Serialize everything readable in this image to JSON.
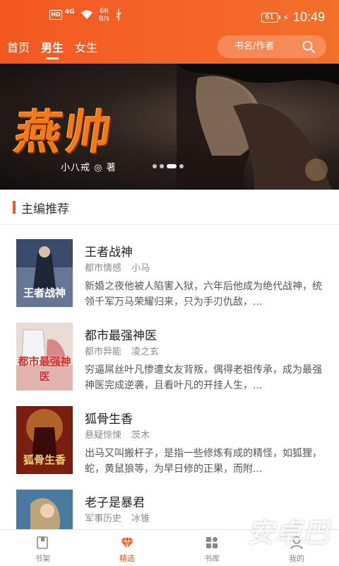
{
  "status_bar": {
    "hd": "HD",
    "network": "4G",
    "speed_value": "66",
    "speed_unit": "B/s",
    "battery": "61",
    "time": "10:49"
  },
  "nav": {
    "tabs": [
      {
        "label": "首页",
        "active": false
      },
      {
        "label": "男生",
        "active": true
      },
      {
        "label": "女生",
        "active": false
      }
    ],
    "search_placeholder": "书名/作者"
  },
  "banner": {
    "title": "燕帅",
    "author_line": "小八戒 ◎ 著",
    "slides": 4,
    "active_slide": 3
  },
  "section": {
    "title": "主编推荐"
  },
  "books": [
    {
      "title": "王者战神",
      "category": "都市情感",
      "author": "小马",
      "desc": "新婚之夜他被人陷害入狱，六年后他成为绝代战神，统领千军万马荣耀归来，只为手刃仇敌，...",
      "cover_text": "王者战神",
      "cover_colors": [
        "#3a4a6a",
        "#8a9ab8"
      ]
    },
    {
      "title": "都市最强神医",
      "category": "都市异能",
      "author": "凌之玄",
      "desc": "穷逼屌丝叶凡惨遭女友背叛，偶得老祖传承，成为最强神医完成逆袭，且看叶凡的开挂人生，...",
      "cover_text": "都市最强神医",
      "cover_colors": [
        "#e8dcd4",
        "#c83a3a"
      ]
    },
    {
      "title": "狐骨生香",
      "category": "悬疑惊悚",
      "author": "茨木",
      "desc": "出马又叫搬杆子，是指一些修炼有成的精怪，如狐狸，蛇，黄鼠狼等，为早日修的正果，而附...",
      "cover_text": "狐骨生香",
      "cover_colors": [
        "#7a1e12",
        "#e09a3a"
      ]
    },
    {
      "title": "老子是暴君",
      "category": "军事历史",
      "author": "冰锥",
      "desc": "",
      "cover_text": "",
      "cover_colors": [
        "#4a7aa0",
        "#d8b070"
      ]
    }
  ],
  "tabbar": [
    {
      "label": "书架",
      "icon": "bookshelf-icon",
      "active": false
    },
    {
      "label": "精选",
      "icon": "diamond-icon",
      "active": true
    },
    {
      "label": "书库",
      "icon": "grid-icon",
      "active": false
    },
    {
      "label": "我的",
      "icon": "user-icon",
      "active": false
    }
  ],
  "watermark": "安卓巴",
  "colors": {
    "accent": "#f2581f",
    "text_primary": "#222222",
    "text_secondary": "#8c8c8c"
  }
}
